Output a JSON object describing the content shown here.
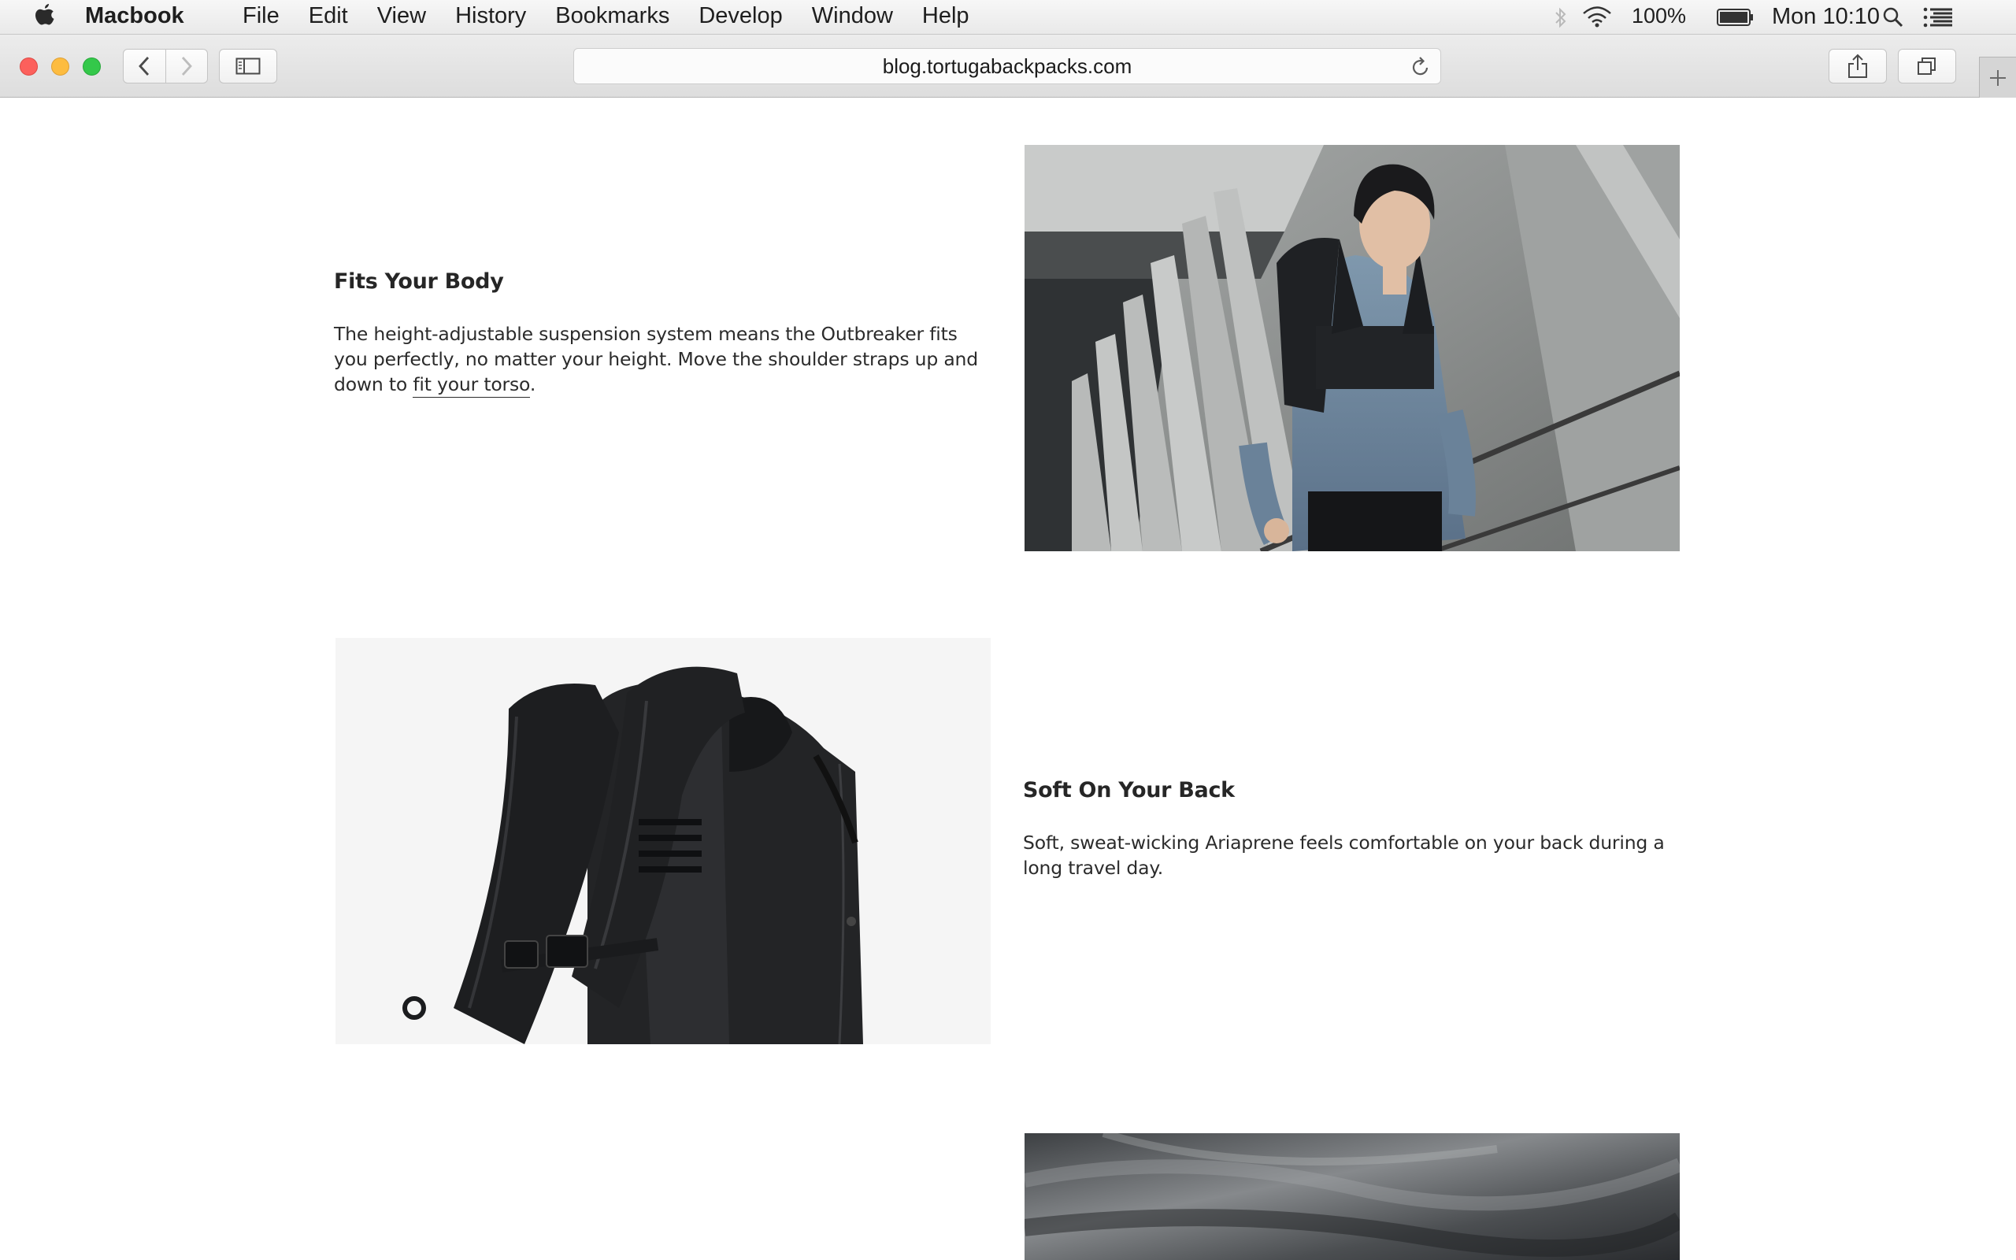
{
  "menubar": {
    "app_name": "Macbook",
    "items": [
      "File",
      "Edit",
      "View",
      "History",
      "Bookmarks",
      "Develop",
      "Window",
      "Help"
    ],
    "battery_percent": "100%",
    "clock": "Mon 10:10",
    "icons": [
      "apple-icon",
      "bluetooth-icon",
      "wifi-icon",
      "battery-icon",
      "spotlight-search-icon",
      "notification-center-icon"
    ]
  },
  "browser": {
    "url": "blog.tortugabackpacks.com",
    "icons": [
      "back-icon",
      "forward-icon",
      "sidebar-icon",
      "reload-icon",
      "share-icon",
      "tabs-overview-icon",
      "new-tab-icon"
    ]
  },
  "sections": [
    {
      "title": "Fits Your Body",
      "text_before_link": "The height-adjustable suspension system means the Outbreaker fits you perfectly, no matter your height. Move the shoulder straps up and down to ",
      "link": "fit your torso",
      "text_after_link": "."
    },
    {
      "title": "Soft On Your Back",
      "text": "Soft, sweat-wicking Ariaprene feels comfortable on your back during a long travel day."
    }
  ],
  "colors": {
    "close": "#fc605c",
    "minimize": "#fdbc40",
    "maximize": "#34c84a",
    "text": "#262626"
  }
}
